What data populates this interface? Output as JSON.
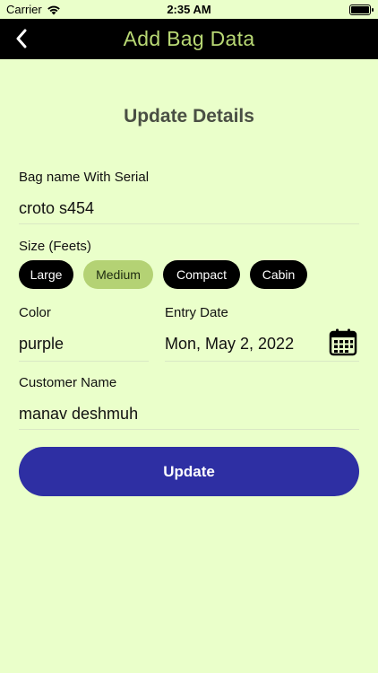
{
  "status_bar": {
    "carrier": "Carrier",
    "time": "2:35 AM",
    "battery_level": 1.0
  },
  "nav": {
    "title": "Add Bag Data",
    "back_icon": "chevron-left-icon",
    "title_color": "#b8d874",
    "bar_color": "#000000"
  },
  "form": {
    "section_title": "Update Details",
    "bag_name": {
      "label": "Bag name With Serial",
      "value": "croto s454"
    },
    "size": {
      "label": "Size (Feets)",
      "options": [
        "Large",
        "Medium",
        "Compact",
        "Cabin"
      ],
      "selected": "Medium"
    },
    "color": {
      "label": "Color",
      "value": "purple"
    },
    "entry_date": {
      "label": "Entry Date",
      "value": "Mon, May 2, 2022",
      "icon": "calendar-icon"
    },
    "customer_name": {
      "label": "Customer Name",
      "value": "manav deshmuh"
    },
    "update_label": "Update"
  },
  "colors": {
    "background": "#eaffca",
    "accent_button": "#2e2fa3",
    "chip_selected": "#b4d274",
    "chip_default": "#000000"
  }
}
